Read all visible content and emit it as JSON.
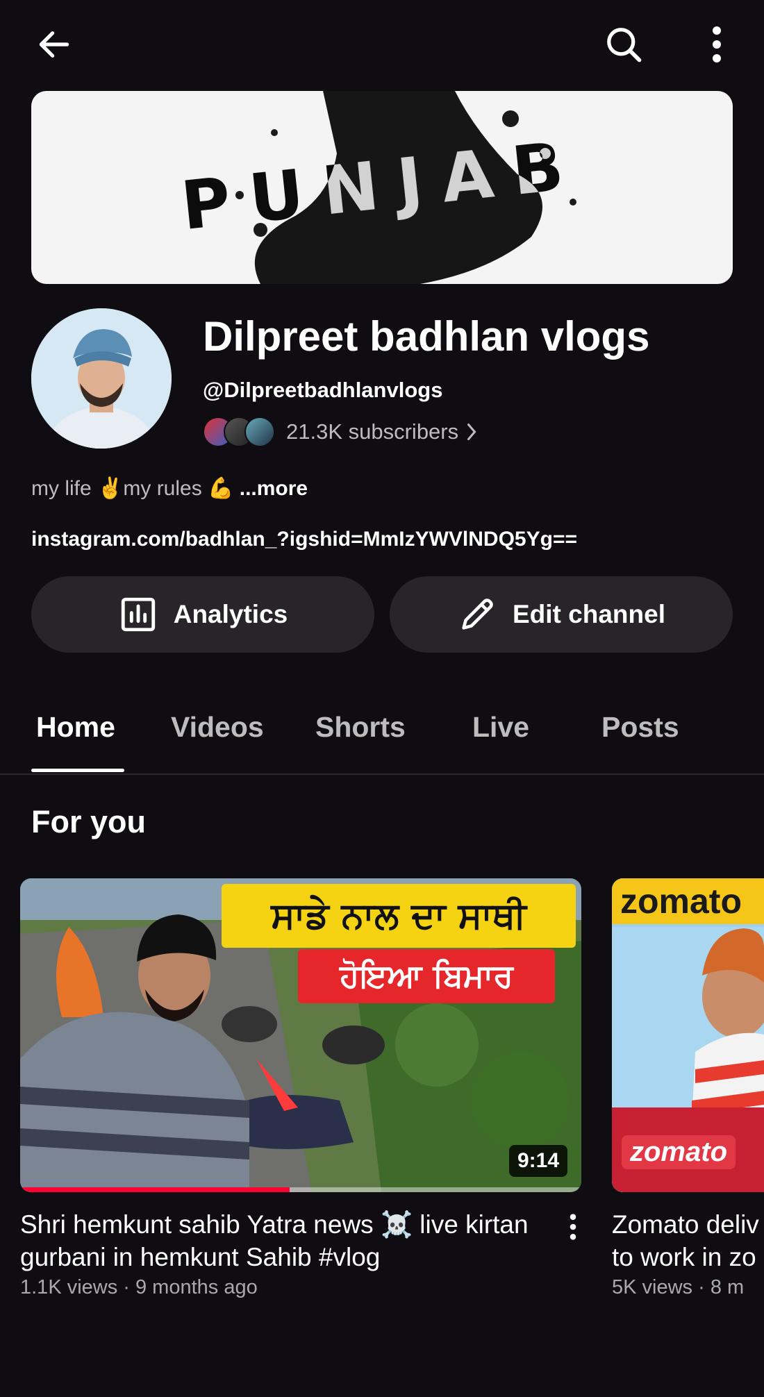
{
  "topbar": {
    "back_icon": "arrow-left-icon",
    "search_icon": "search-icon",
    "menu_icon": "more-vertical-icon"
  },
  "banner": {
    "text": "PUNJAB"
  },
  "channel": {
    "name": "Dilpreet badhlan vlogs",
    "handle": "@Dilpreetbadhlanvlogs",
    "subscribers": "21.3K subscribers",
    "bio_text": "my life ✌️my rules 💪",
    "bio_more": "...more",
    "link": "instagram.com/badhlan_?igshid=MmIzYWVlNDQ5Yg=="
  },
  "actions": {
    "analytics_label": "Analytics",
    "edit_label": "Edit channel"
  },
  "tabs": [
    {
      "label": "Home"
    },
    {
      "label": "Videos"
    },
    {
      "label": "Shorts"
    },
    {
      "label": "Live"
    },
    {
      "label": "Posts"
    }
  ],
  "section": {
    "title": "For you"
  },
  "videos": [
    {
      "title": "Shri hemkunt sahib Yatra news ☠️ live kirtan gurbani in hemkunt Sahib #vlog",
      "meta": "1.1K views · 9 months ago",
      "duration": "9:14",
      "watched_fraction": 0.48,
      "thumb_line1": "ਸਾਡੇ ਨਾਲ ਦਾ ਸਾਥੀ",
      "thumb_line2": "ਹੋਇਆ ਬਿਮਾਰ"
    },
    {
      "title": "Zomato deliv to work in zo",
      "meta": "5K views · 8 m",
      "thumb_brand_top": "zomato",
      "thumb_brand_bottom": "zomato"
    }
  ],
  "colors": {
    "background": "#0f0d12",
    "pill": "#27252a",
    "progress": "#ff0033",
    "thumb_banner_yellow": "#f5d313",
    "thumb_banner_red": "#e5272b",
    "zomato_red": "#e23744"
  }
}
